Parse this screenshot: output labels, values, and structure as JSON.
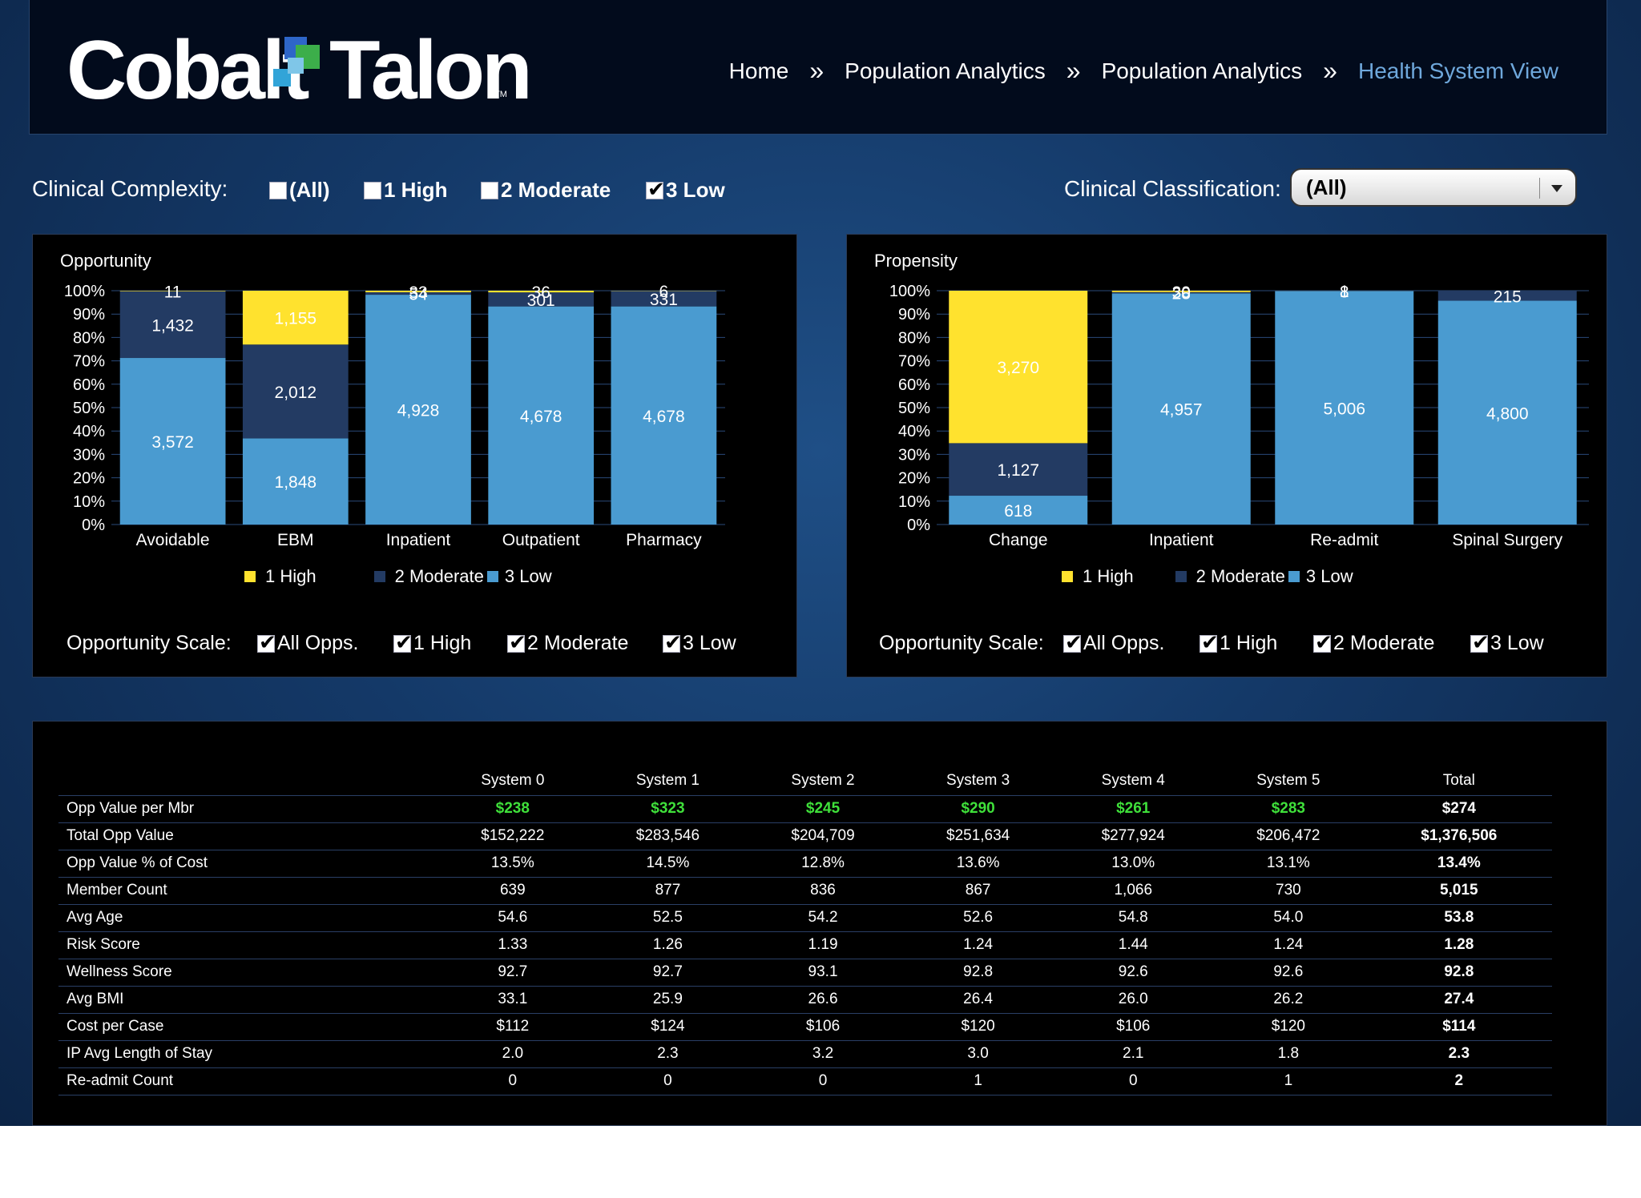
{
  "header": {
    "logo_left": "Cobalt",
    "logo_right": "Talon",
    "logo_tm": "TM",
    "breadcrumb": [
      "Home",
      "Population Analytics",
      "Population Analytics",
      "Health System View"
    ],
    "separator": "»"
  },
  "filters": {
    "complexity_label": "Clinical Complexity:",
    "complexity_options": [
      {
        "label": "(All)",
        "checked": false
      },
      {
        "label": "1 High",
        "checked": false
      },
      {
        "label": "2 Moderate",
        "checked": false
      },
      {
        "label": "3 Low",
        "checked": true
      }
    ],
    "classification_label": "Clinical Classification:",
    "classification_value": "(All)"
  },
  "colors": {
    "high": "#ffe22e",
    "moderate": "#233b63",
    "low": "#4a9bd0"
  },
  "chart_data": [
    {
      "type": "bar",
      "title": "Opportunity",
      "stacked": "percent",
      "categories": [
        "Avoidable",
        "EBM",
        "Inpatient",
        "Outpatient",
        "Pharmacy"
      ],
      "series": [
        {
          "name": "3 Low",
          "values": [
            3572,
            1848,
            4928,
            4678,
            4678
          ],
          "labels": [
            "3,572",
            "1,848",
            "4,928",
            "4,678",
            "4,678"
          ]
        },
        {
          "name": "2 Moderate",
          "values": [
            1432,
            2012,
            54,
            301,
            331
          ],
          "labels": [
            "1,432",
            "2,012",
            "54",
            "301",
            "331"
          ]
        },
        {
          "name": "1 High",
          "values": [
            11,
            1155,
            33,
            36,
            6
          ],
          "labels": [
            "11",
            "1,155",
            "33",
            "36",
            "6"
          ]
        }
      ],
      "yticks": [
        "100%",
        "90%",
        "80%",
        "70%",
        "60%",
        "50%",
        "40%",
        "30%",
        "20%",
        "10%",
        "0%"
      ],
      "ylim": [
        0,
        100
      ],
      "legend": [
        "1 High",
        "2 Moderate",
        "3 Low"
      ],
      "legend_position": "bottom"
    },
    {
      "type": "bar",
      "title": "Propensity",
      "stacked": "percent",
      "categories": [
        "Change",
        "Inpatient",
        "Re-admit",
        "Spinal Surgery"
      ],
      "series": [
        {
          "name": "3 Low",
          "values": [
            618,
            4957,
            5006,
            4800
          ],
          "labels": [
            "618",
            "4,957",
            "5,006",
            "4,800"
          ]
        },
        {
          "name": "2 Moderate",
          "values": [
            1127,
            28,
            8,
            215
          ],
          "labels": [
            "1,127",
            "28",
            "8",
            "215"
          ]
        },
        {
          "name": "1 High",
          "values": [
            3270,
            30,
            1,
            0
          ],
          "labels": [
            "3,270",
            "30",
            "1",
            ""
          ]
        }
      ],
      "yticks": [
        "100%",
        "90%",
        "80%",
        "70%",
        "60%",
        "50%",
        "40%",
        "30%",
        "20%",
        "10%",
        "0%"
      ],
      "ylim": [
        0,
        100
      ],
      "legend": [
        "1 High",
        "2 Moderate",
        "3 Low"
      ],
      "legend_position": "bottom"
    }
  ],
  "opportunity_scale": {
    "label": "Opportunity Scale:",
    "options": [
      {
        "label": "All Opps.",
        "checked": true
      },
      {
        "label": "1 High",
        "checked": true
      },
      {
        "label": "2 Moderate",
        "checked": true
      },
      {
        "label": "3 Low",
        "checked": true
      }
    ]
  },
  "table": {
    "columns": [
      "System 0",
      "System 1",
      "System 2",
      "System 3",
      "System 4",
      "System 5",
      "Total"
    ],
    "rows": [
      {
        "label": "Opp Value per Mbr",
        "values": [
          "$238",
          "$323",
          "$245",
          "$290",
          "$261",
          "$283",
          "$274"
        ],
        "highlight": true
      },
      {
        "label": "Total Opp Value",
        "values": [
          "$152,222",
          "$283,546",
          "$204,709",
          "$251,634",
          "$277,924",
          "$206,472",
          "$1,376,506"
        ]
      },
      {
        "label": "Opp Value % of Cost",
        "values": [
          "13.5%",
          "14.5%",
          "12.8%",
          "13.6%",
          "13.0%",
          "13.1%",
          "13.4%"
        ]
      },
      {
        "label": "Member Count",
        "values": [
          "639",
          "877",
          "836",
          "867",
          "1,066",
          "730",
          "5,015"
        ]
      },
      {
        "label": "Avg Age",
        "values": [
          "54.6",
          "52.5",
          "54.2",
          "52.6",
          "54.8",
          "54.0",
          "53.8"
        ]
      },
      {
        "label": "Risk Score",
        "values": [
          "1.33",
          "1.26",
          "1.19",
          "1.24",
          "1.44",
          "1.24",
          "1.28"
        ]
      },
      {
        "label": "Wellness Score",
        "values": [
          "92.7",
          "92.7",
          "93.1",
          "92.8",
          "92.6",
          "92.6",
          "92.8"
        ]
      },
      {
        "label": "Avg BMI",
        "values": [
          "33.1",
          "25.9",
          "26.6",
          "26.4",
          "26.0",
          "26.2",
          "27.4"
        ]
      },
      {
        "label": "Cost per Case",
        "values": [
          "$112",
          "$124",
          "$106",
          "$120",
          "$106",
          "$120",
          "$114"
        ]
      },
      {
        "label": "IP Avg Length of Stay",
        "values": [
          "2.0",
          "2.3",
          "3.2",
          "3.0",
          "2.1",
          "1.8",
          "2.3"
        ]
      },
      {
        "label": "Re-admit Count",
        "values": [
          "0",
          "0",
          "0",
          "1",
          "0",
          "1",
          "2"
        ]
      }
    ]
  }
}
